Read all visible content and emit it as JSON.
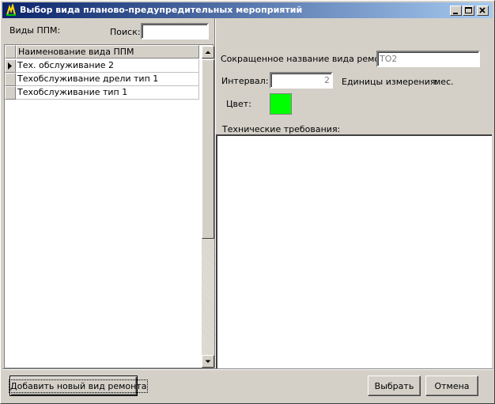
{
  "window": {
    "title": "Выбор вида планово-предупредительных мероприятий"
  },
  "left_panel": {
    "label": "Виды ППМ:",
    "search_label": "Поиск:",
    "search_value": "",
    "grid": {
      "column_header": "Наименование вида ППМ",
      "rows": [
        "Тех. обслуживание 2",
        "Техобслуживание дрели тип 1",
        "Техобслуживание тип 1"
      ],
      "selected_index": 0
    }
  },
  "details": {
    "short_name_label": "Сокращенное название вида ремонта:",
    "short_name_value": "ТО2",
    "interval_label": "Интервал:",
    "interval_value": "2",
    "units_label": "Единицы измерения:",
    "units_value": "мес.",
    "color_label": "Цвет:",
    "color_value": "#00ff00",
    "tech_req_label": "Технические требования:",
    "tech_req_value": ""
  },
  "buttons": {
    "add": "Добавить новый вид ремонта",
    "select": "Выбрать",
    "cancel": "Отмена"
  },
  "icons": {
    "app": "app-icon",
    "minimize": "minimize-icon",
    "maximize": "maximize-icon",
    "close": "close-icon",
    "scroll_up": "scroll-up-arrow-icon",
    "scroll_down": "scroll-down-arrow-icon",
    "row_pointer": "row-pointer-icon"
  }
}
